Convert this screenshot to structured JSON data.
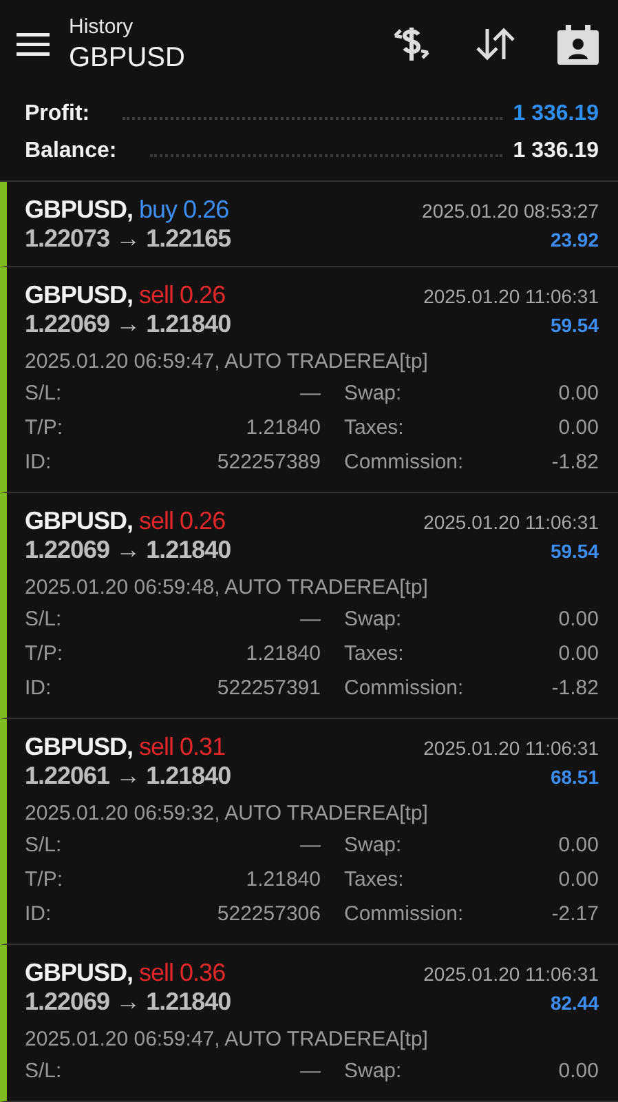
{
  "header": {
    "subtitle": "History",
    "title": "GBPUSD"
  },
  "summary": [
    {
      "label": "Profit:",
      "value": "1 336.19",
      "kind": "profit"
    },
    {
      "label": "Balance:",
      "value": "1 336.19",
      "kind": "balance"
    }
  ],
  "trades": [
    {
      "symbol": "GBPUSD,",
      "kind": "buy",
      "action": "buy 0.26",
      "prices": "1.22073 → 1.22165",
      "time": "2025.01.20 08:53:27",
      "profit": "23.92"
    },
    {
      "symbol": "GBPUSD,",
      "kind": "sell",
      "action": "sell 0.26",
      "prices": "1.22069 → 1.21840",
      "time": "2025.01.20 11:06:31",
      "profit": "59.54",
      "comment": "2025.01.20 06:59:47, AUTO TRADEREA[tp]",
      "details": [
        [
          "S/L:",
          "—",
          "Swap:",
          "0.00"
        ],
        [
          "T/P:",
          "1.21840",
          "Taxes:",
          "0.00"
        ],
        [
          "ID:",
          "522257389",
          "Commission:",
          "-1.82"
        ]
      ]
    },
    {
      "symbol": "GBPUSD,",
      "kind": "sell",
      "action": "sell 0.26",
      "prices": "1.22069 → 1.21840",
      "time": "2025.01.20 11:06:31",
      "profit": "59.54",
      "comment": "2025.01.20 06:59:48, AUTO TRADEREA[tp]",
      "details": [
        [
          "S/L:",
          "—",
          "Swap:",
          "0.00"
        ],
        [
          "T/P:",
          "1.21840",
          "Taxes:",
          "0.00"
        ],
        [
          "ID:",
          "522257391",
          "Commission:",
          "-1.82"
        ]
      ]
    },
    {
      "symbol": "GBPUSD,",
      "kind": "sell",
      "action": "sell 0.31",
      "prices": "1.22061 → 1.21840",
      "time": "2025.01.20 11:06:31",
      "profit": "68.51",
      "comment": "2025.01.20 06:59:32, AUTO TRADEREA[tp]",
      "details": [
        [
          "S/L:",
          "—",
          "Swap:",
          "0.00"
        ],
        [
          "T/P:",
          "1.21840",
          "Taxes:",
          "0.00"
        ],
        [
          "ID:",
          "522257306",
          "Commission:",
          "-2.17"
        ]
      ]
    },
    {
      "symbol": "GBPUSD,",
      "kind": "sell",
      "action": "sell 0.36",
      "prices": "1.22069 → 1.21840",
      "time": "2025.01.20 11:06:31",
      "profit": "82.44",
      "comment": "2025.01.20 06:59:47, AUTO TRADEREA[tp]",
      "details": [
        [
          "S/L:",
          "—",
          "Swap:",
          "0.00"
        ]
      ]
    }
  ]
}
